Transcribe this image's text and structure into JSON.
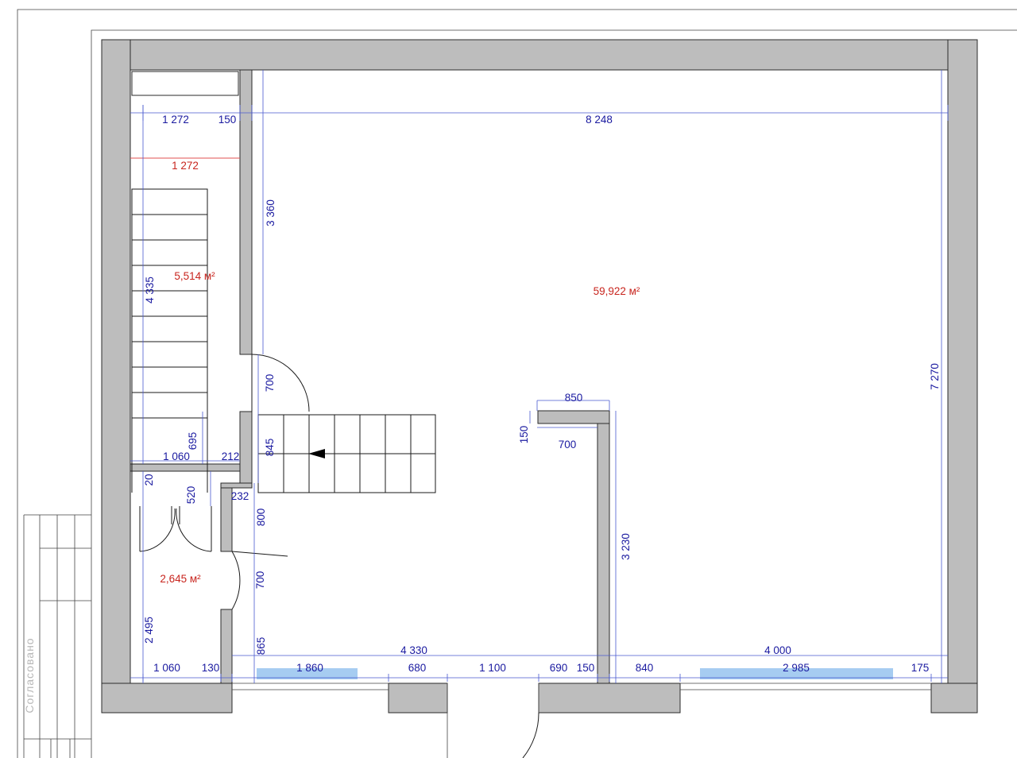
{
  "stamp_text": "Согласовано",
  "rooms": [
    {
      "name": "staircase-room",
      "area": "5,514 м²"
    },
    {
      "name": "hall-room",
      "area": "59,922 м²"
    },
    {
      "name": "vestibule-room",
      "area": "2,645 м²"
    }
  ],
  "dims": {
    "top_1272": "1 272",
    "top_150": "150",
    "top_8248": "8 248",
    "red_1272": "1 272",
    "v_3360": "3 360",
    "v_4335": "4 335",
    "v_700_a": "700",
    "v_695": "695",
    "d_1060_a": "1 060",
    "d_212": "212",
    "v_845": "845",
    "d_850": "850",
    "v_150": "150",
    "d_700": "700",
    "v_7270": "7 270",
    "v_20": "20",
    "v_520": "520",
    "d_232": "232",
    "v_800": "800",
    "v_700_b": "700",
    "v_3230": "3 230",
    "v_2495": "2 495",
    "v_865": "865",
    "d_4330": "4 330",
    "d_4000": "4 000",
    "b_1060": "1 060",
    "b_130": "130",
    "b_1860": "1 860",
    "b_680": "680",
    "b_1100": "1 100",
    "b_690": "690",
    "b_150": "150",
    "b_840": "840",
    "b_2985": "2 985",
    "b_175": "175"
  },
  "colors": {
    "wall": "#bdbdbd",
    "dimension": "#1a1aa0",
    "area": "#c8251e",
    "window": "#9cc6f0"
  }
}
